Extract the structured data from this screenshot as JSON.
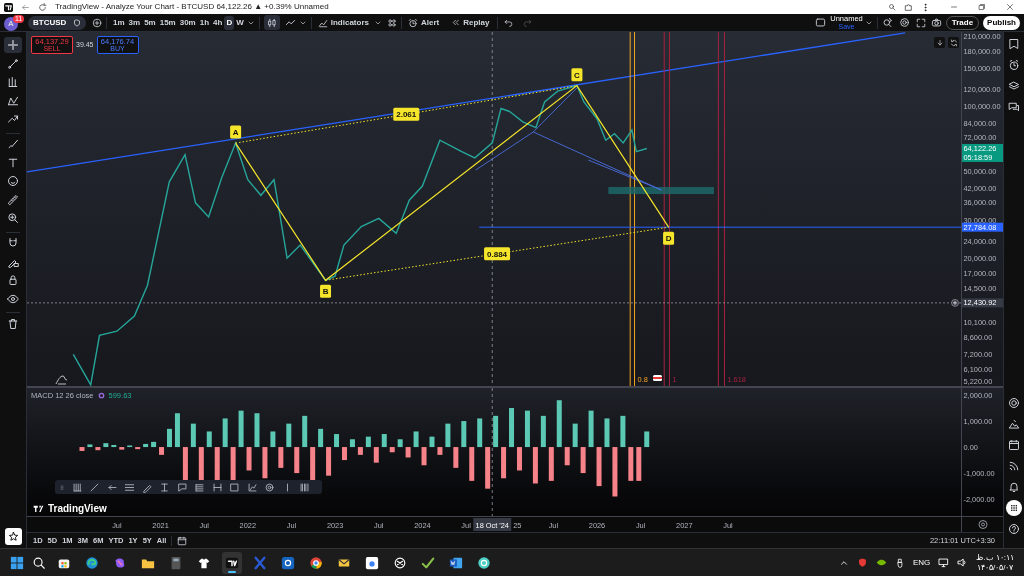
{
  "browser": {
    "title": "TradingView - Analyze Your Chart - BTCUSD 64,122.26 ▲ +0.39% Unnamed"
  },
  "toolbar": {
    "avatar": "A",
    "notifications": "11",
    "symbol": "BTCUSD",
    "intervals": [
      {
        "label": "1m",
        "selected": false
      },
      {
        "label": "3m",
        "selected": false
      },
      {
        "label": "5m",
        "selected": false
      },
      {
        "label": "15m",
        "selected": false
      },
      {
        "label": "30m",
        "selected": false
      },
      {
        "label": "1h",
        "selected": false
      },
      {
        "label": "4h",
        "selected": false
      },
      {
        "label": "D",
        "selected": true
      },
      {
        "label": "W",
        "selected": false
      }
    ],
    "candles_selected": true,
    "indicators": "Indicators",
    "alert": "Alert",
    "replay": "Replay",
    "layout_name": "Unnamed",
    "layout_status": "Save",
    "trade": "Trade",
    "publish": "Publish"
  },
  "left_toolbar": [
    {
      "selected": true
    },
    {
      "selected": false
    },
    {
      "selected": false
    },
    {
      "selected": false
    },
    {
      "selected": false
    },
    {
      "selected": false
    },
    {
      "selected": false
    },
    {
      "selected": false
    },
    {
      "selected": false
    },
    {
      "selected": false
    },
    {
      "selected": false
    },
    {
      "selected": false
    },
    {
      "selected": false
    },
    {
      "selected": false
    },
    {
      "selected": false
    }
  ],
  "order_panel": {
    "sell_price": "64,137.29",
    "sell": "SELL",
    "spread": "39.45",
    "buy_price": "64,176.74",
    "buy": "BUY"
  },
  "main_chart": {
    "price_axis_labels": [
      "210,000.00",
      "180,000.00",
      "150,000.00",
      "120,000.00",
      "100,000.00",
      "84,000.00",
      "72,000.00",
      "50,000.00",
      "42,000.00",
      "36,000.00",
      "30,000.00",
      "24,000.00",
      "20,000.00",
      "17,000.00",
      "14,500.00",
      "10,100.00",
      "8,600.00",
      "7,200.00",
      "6,100.00",
      "5,220.00"
    ],
    "time_axis_labels": [
      "Jul",
      "2021",
      "Jul",
      "2022",
      "Jul",
      "2023",
      "Jul",
      "2024",
      "Jul",
      "Jul",
      "2026",
      "Jul",
      "2027",
      "Jul"
    ],
    "pattern_labels": [
      "A",
      "B",
      "C",
      "D"
    ],
    "ratio_labels": [
      "2.061",
      "0.884"
    ],
    "time_zone_labels": [
      "0.8",
      "1",
      "1.618"
    ],
    "last_price": "64,122.26",
    "countdown": "05:18:59",
    "line_price": "27,784.08",
    "crosshair_price": "12,430.92",
    "crosshair_date": "18 Oct '24",
    "partial_tick_label": "25"
  },
  "macd": {
    "title": "MACD 12 26 close",
    "value": "599.63",
    "axis_labels": [
      "2,000.00",
      "1,000.00",
      "0.00",
      "-1,000.00",
      "-2,000.00"
    ]
  },
  "logo": "TradingView",
  "bottom_bar": {
    "ranges": [
      "1D",
      "5D",
      "1M",
      "3M",
      "6M",
      "YTD",
      "1Y",
      "5Y",
      "All"
    ],
    "clock": "22:11:01 UTC+3:30"
  },
  "right_sidebar": [
    {
      "active": false
    },
    {
      "active": false
    },
    {
      "active": false
    },
    {
      "active": false
    },
    {
      "active": false
    },
    {
      "active": false
    },
    {
      "active": false
    },
    {
      "active": false
    },
    {
      "active": false
    },
    {
      "active": true
    },
    {
      "active": false
    }
  ],
  "taskbar": {
    "apps": [
      {
        "active": false
      },
      {
        "active": false
      },
      {
        "active": false
      },
      {
        "active": false
      },
      {
        "active": false
      },
      {
        "active": false
      },
      {
        "active": true
      },
      {
        "active": false
      },
      {
        "active": false
      },
      {
        "active": false
      },
      {
        "active": false
      },
      {
        "active": false
      },
      {
        "active": false
      },
      {
        "active": false
      },
      {
        "active": false
      },
      {
        "active": false
      }
    ],
    "language": "ENG",
    "time": "۱۰:۱۱ ب.ظ",
    "date": "۱۴۰۵/۰۵/۰۷"
  }
}
